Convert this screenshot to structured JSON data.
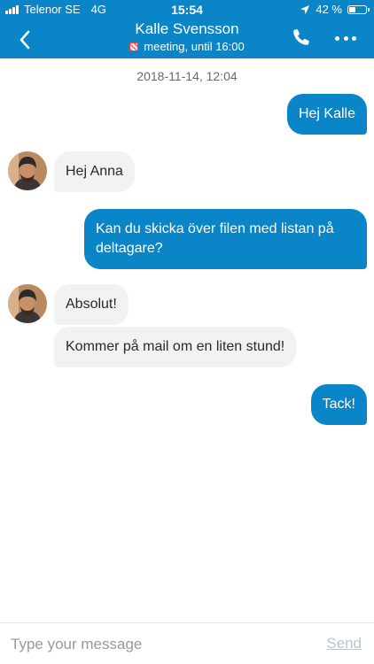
{
  "status_bar": {
    "carrier": "Telenor SE",
    "network": "4G",
    "time": "15:54",
    "battery_percent": "42 %",
    "battery_level": 0.42
  },
  "header": {
    "contact_name": "Kalle Svensson",
    "presence": "meeting, until 16:00",
    "icons": {
      "back": "chevron-left-icon",
      "call": "phone-icon",
      "more": "more-horizontal-icon"
    }
  },
  "chat": {
    "date_separator": "2018-11-14, 12:04",
    "messages": [
      {
        "direction": "out",
        "text": "Hej Kalle"
      },
      {
        "direction": "in",
        "text": "Hej Anna"
      },
      {
        "direction": "out",
        "text": "Kan du skicka över filen med listan på deltagare?"
      },
      {
        "direction": "in",
        "text": "Absolut!"
      },
      {
        "direction": "in",
        "text": "Kommer på mail om en liten stund!"
      },
      {
        "direction": "out",
        "text": "Tack!"
      }
    ]
  },
  "composer": {
    "placeholder": "Type your message",
    "value": "",
    "send_label": "Send"
  },
  "colors": {
    "accent": "#0a86c8",
    "incoming_bubble": "#f1f2f4",
    "presence_busy": "#e14a4a"
  }
}
